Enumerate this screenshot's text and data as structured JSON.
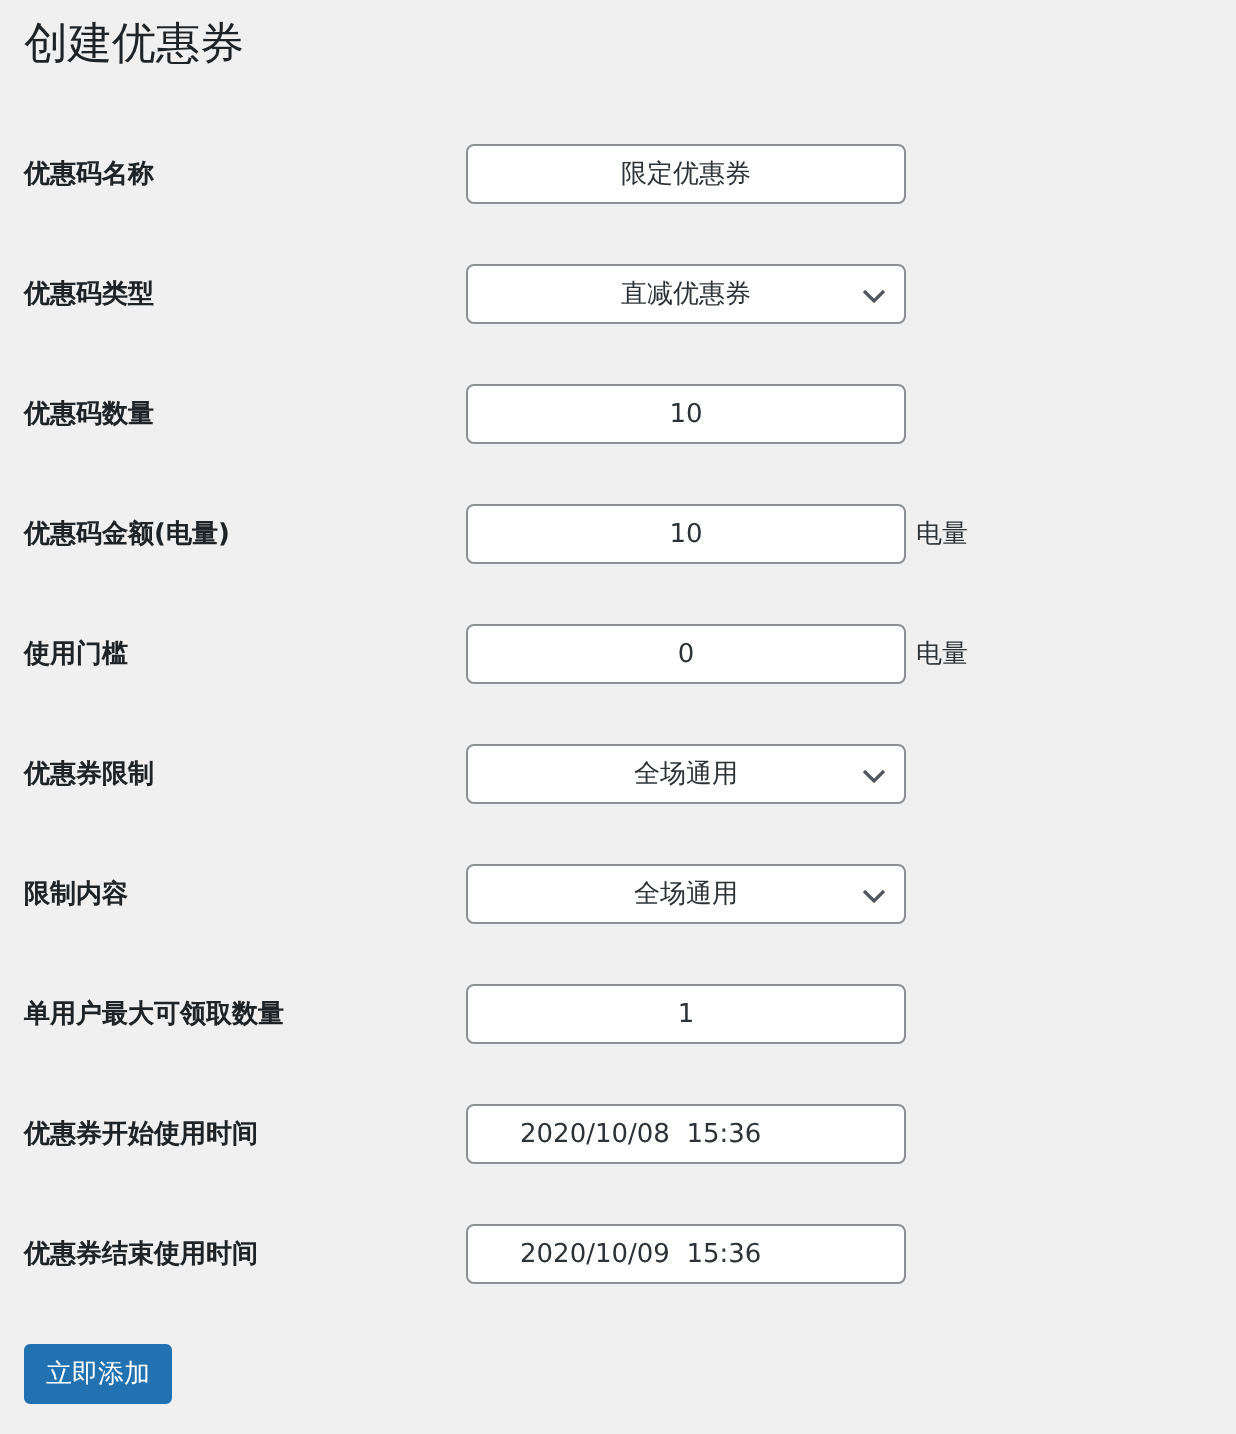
{
  "title": "创建优惠券",
  "fields": [
    {
      "label": "优惠码名称",
      "kind": "text",
      "value": "限定优惠券"
    },
    {
      "label": "优惠码类型",
      "kind": "select",
      "value": "直减优惠券"
    },
    {
      "label": "优惠码数量",
      "kind": "text",
      "value": "10"
    },
    {
      "label": "优惠码金额(电量)",
      "kind": "text",
      "value": "10",
      "suffix": "电量"
    },
    {
      "label": "使用门槛",
      "kind": "text",
      "value": "0",
      "suffix": "电量"
    },
    {
      "label": "优惠券限制",
      "kind": "select",
      "value": "全场通用"
    },
    {
      "label": "限制内容",
      "kind": "select",
      "value": "全场通用"
    },
    {
      "label": "单用户最大可领取数量",
      "kind": "text",
      "value": "1"
    },
    {
      "label": "优惠券开始使用时间",
      "kind": "datetime",
      "value": "2020/10/08  15:36"
    },
    {
      "label": "优惠券结束使用时间",
      "kind": "datetime",
      "value": "2020/10/09  15:36"
    }
  ],
  "submit": "立即添加"
}
